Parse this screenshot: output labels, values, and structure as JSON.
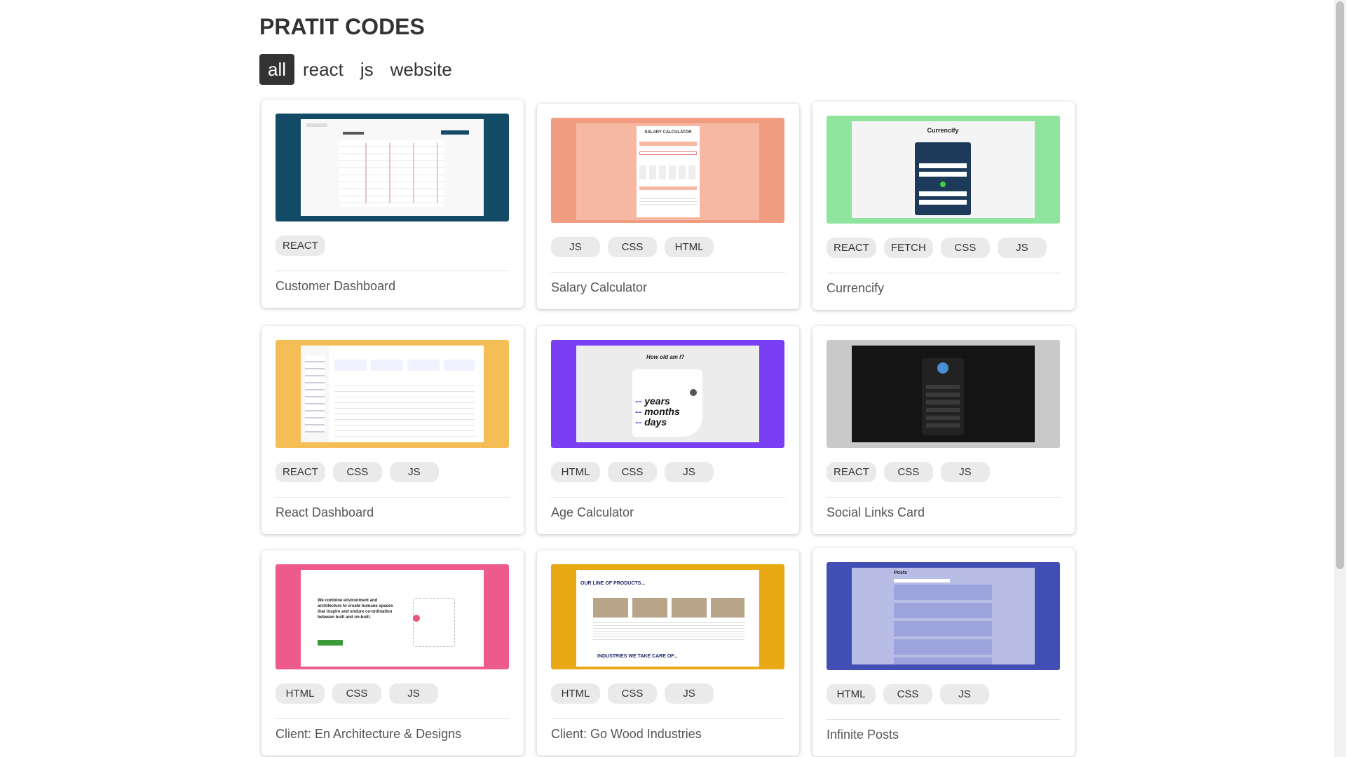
{
  "header": {
    "title": "PRATIT CODES"
  },
  "filters": [
    {
      "label": "all",
      "active": true
    },
    {
      "label": "react",
      "active": false
    },
    {
      "label": "js",
      "active": false
    },
    {
      "label": "website",
      "active": false
    }
  ],
  "cards": [
    {
      "title": "Customer Dashboard",
      "tags": [
        "REACT"
      ],
      "thumb_color": "#134b66"
    },
    {
      "title": "Salary Calculator",
      "tags": [
        "JS",
        "CSS",
        "HTML"
      ],
      "thumb_color": "#f09d82"
    },
    {
      "title": "Currencify",
      "tags": [
        "REACT",
        "FETCH",
        "CSS",
        "JS"
      ],
      "thumb_color": "#8fe59d"
    },
    {
      "title": "React Dashboard",
      "tags": [
        "REACT",
        "CSS",
        "JS"
      ],
      "thumb_color": "#f5bd55"
    },
    {
      "title": "Age Calculator",
      "tags": [
        "HTML",
        "CSS",
        "JS"
      ],
      "thumb_color": "#7a3ff3"
    },
    {
      "title": "Social Links Card",
      "tags": [
        "REACT",
        "CSS",
        "JS"
      ],
      "thumb_color": "#c9c9c9"
    },
    {
      "title": "Client: En Architecture & Designs",
      "tags": [
        "HTML",
        "CSS",
        "JS"
      ],
      "thumb_color": "#ec5b8b"
    },
    {
      "title": "Client: Go Wood Industries",
      "tags": [
        "HTML",
        "CSS",
        "JS"
      ],
      "thumb_color": "#e9a915"
    },
    {
      "title": "Infinite Posts",
      "tags": [
        "HTML",
        "CSS",
        "JS"
      ],
      "thumb_color": "#414fb4"
    }
  ],
  "thumb_text": {
    "salary_heading": "SALARY CALCULATOR",
    "currencify_heading": "Currencify",
    "age_question": "How old am I?",
    "age_years": "years",
    "age_months": "months",
    "age_days": "days",
    "age_placeholder": "--",
    "arch_tagline": "We combine environment and architecture to create humane spaces that inspire and endure co-ordination between built and un-built.",
    "wood_heading": "OUR LINE OF PRODUCTS...",
    "wood_sub": "INDUSTRIES WE TAKE CARE OF...",
    "posts_heading": "Posts"
  }
}
